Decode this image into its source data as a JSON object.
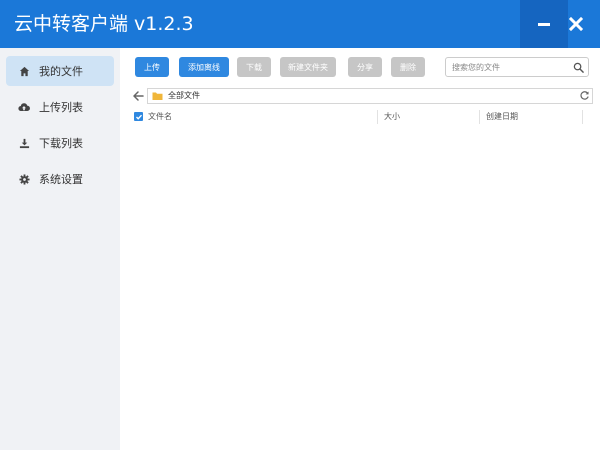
{
  "window": {
    "title": "云中转客户端 v1.2.3",
    "title_bar_color": "#1b78d8",
    "controls": {
      "minimize_icon": "minimize-icon",
      "close_icon": "close-icon"
    }
  },
  "sidebar": {
    "items": [
      {
        "label": "我的文件",
        "icon": "home-icon",
        "active": true
      },
      {
        "label": "上传列表",
        "icon": "cloud-upload-icon",
        "active": false
      },
      {
        "label": "下载列表",
        "icon": "download-icon",
        "active": false
      },
      {
        "label": "系统设置",
        "icon": "gear-icon",
        "active": false
      }
    ]
  },
  "toolbar": {
    "upload": "上传",
    "add_offline": "添加离线",
    "download": "下载",
    "new_folder": "新建文件夹",
    "share": "分享",
    "delete": "删除",
    "primary_color": "#2f88e0",
    "disabled_color": "#c6c6c6"
  },
  "search": {
    "placeholder": "搜索您的文件",
    "icon": "search-icon"
  },
  "path": {
    "current": "全部文件",
    "back_icon": "arrow-left-icon",
    "folder_icon": "folder-icon",
    "refresh_icon": "refresh-icon"
  },
  "file_list": {
    "select_all_checked": true,
    "columns": {
      "name": "文件名",
      "size": "大小",
      "created": "创建日期"
    },
    "rows": []
  }
}
